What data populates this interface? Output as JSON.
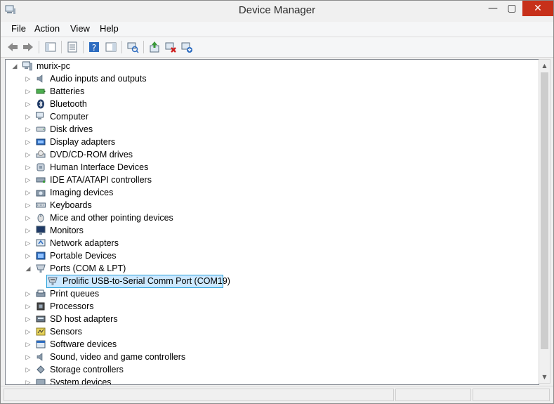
{
  "window": {
    "title": "Device Manager"
  },
  "menu": [
    "File",
    "Action",
    "View",
    "Help"
  ],
  "toolbar": [
    {
      "name": "back-icon"
    },
    {
      "name": "forward-icon"
    },
    {
      "name": "show-hide-console-tree-icon"
    },
    {
      "name": "properties-icon"
    },
    {
      "name": "help-icon"
    },
    {
      "name": "show-hide-action-pane-icon"
    },
    {
      "name": "scan-hardware-changes-icon"
    },
    {
      "name": "update-driver-icon"
    },
    {
      "name": "disable-device-icon"
    },
    {
      "name": "uninstall-device-icon"
    }
  ],
  "tree": {
    "root": "murix-pc",
    "categories": [
      "Audio inputs and outputs",
      "Batteries",
      "Bluetooth",
      "Computer",
      "Disk drives",
      "Display adapters",
      "DVD/CD-ROM drives",
      "Human Interface Devices",
      "IDE ATA/ATAPI controllers",
      "Imaging devices",
      "Keyboards",
      "Mice and other pointing devices",
      "Monitors",
      "Network adapters",
      "Portable Devices",
      "Ports (COM & LPT)"
    ],
    "expanded_child": "Prolific USB-to-Serial Comm Port (COM19)",
    "categories_after": [
      "Print queues",
      "Processors",
      "SD host adapters",
      "Sensors",
      "Software devices",
      "Sound, video and game controllers",
      "Storage controllers",
      "System devices"
    ]
  },
  "icons": {
    "categories": [
      "speaker-icon",
      "battery-icon",
      "bluetooth-icon",
      "computer-icon",
      "disk-drive-icon",
      "display-adapter-icon",
      "dvd-drive-icon",
      "hid-icon",
      "ide-controller-icon",
      "camera-icon",
      "keyboard-icon",
      "mouse-icon",
      "monitor-icon",
      "network-adapter-icon",
      "portable-device-icon",
      "port-icon"
    ],
    "categories_after": [
      "printer-icon",
      "processor-icon",
      "sd-card-icon",
      "sensor-icon",
      "software-device-icon",
      "sound-icon",
      "storage-controller-icon",
      "system-device-icon"
    ]
  },
  "colors": {
    "selection": "#cce8ff",
    "selection_border": "#26a0da",
    "close_button": "#c7301a"
  }
}
